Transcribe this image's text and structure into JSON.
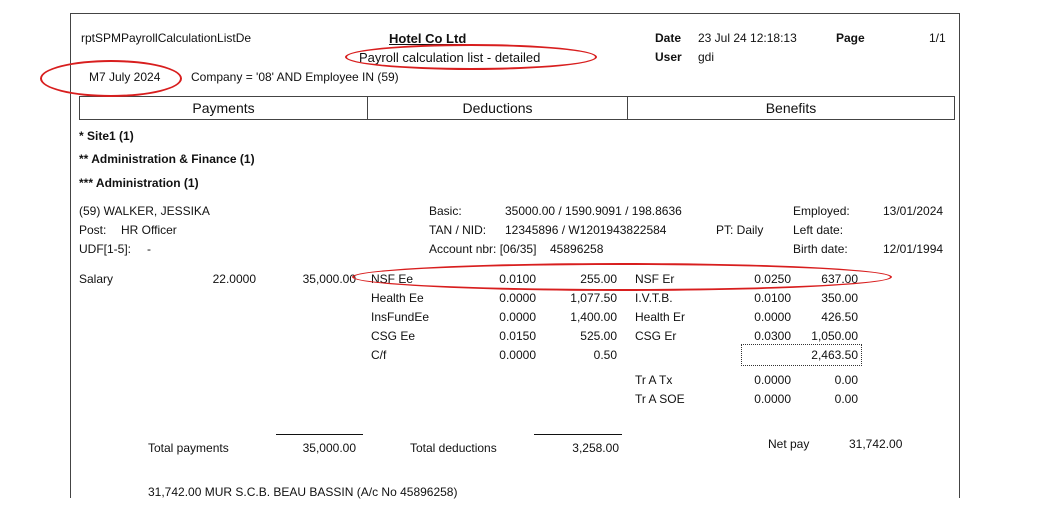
{
  "header": {
    "report_id": "rptSPMPayrollCalculationListDe",
    "company_name": "Hotel Co Ltd",
    "subtitle": "Payroll calculation list - detailed",
    "period": "M7 July 2024",
    "filter": "Company = '08' AND Employee IN (59)",
    "date_label": "Date",
    "date_value": "23 Jul 24 12:18:13",
    "page_label": "Page",
    "page_value": "1/1",
    "user_label": "User",
    "user_value": "gdi"
  },
  "sections": {
    "payments": "Payments",
    "deductions": "Deductions",
    "benefits": "Benefits"
  },
  "groups": {
    "level1": "* Site1 (1)",
    "level2": "** Administration & Finance (1)",
    "level3": "*** Administration (1)"
  },
  "employee": {
    "name": "(59) WALKER, JESSIKA",
    "post_label": "Post:",
    "post_value": "HR Officer",
    "udf_label": "UDF[1-5]:",
    "udf_value": "-",
    "basic_label": "Basic:",
    "basic_value": "35000.00 / 1590.9091 / 198.8636",
    "tan_label": "TAN / NID:",
    "tan_value": "12345896 / W1201943822584",
    "pt": "PT: Daily",
    "account_label": "Account nbr: [06/35]",
    "account_value": "45896258",
    "employed_label": "Employed:",
    "employed_value": "13/01/2024",
    "left_label": "Left date:",
    "birth_label": "Birth date:",
    "birth_value": "12/01/1994"
  },
  "payments": [
    {
      "name": "Salary",
      "rate": "22.0000",
      "amount": "35,000.00"
    }
  ],
  "deductions": [
    {
      "name": "NSF Ee",
      "rate": "0.0100",
      "amount": "255.00"
    },
    {
      "name": "Health Ee",
      "rate": "0.0000",
      "amount": "1,077.50"
    },
    {
      "name": "InsFundEe",
      "rate": "0.0000",
      "amount": "1,400.00"
    },
    {
      "name": "CSG Ee",
      "rate": "0.0150",
      "amount": "525.00"
    },
    {
      "name": "C/f",
      "rate": "0.0000",
      "amount": "0.50"
    }
  ],
  "benefits": [
    {
      "name": "NSF Er",
      "rate": "0.0250",
      "amount": "637.00"
    },
    {
      "name": "I.V.T.B.",
      "rate": "0.0100",
      "amount": "350.00"
    },
    {
      "name": "Health Er",
      "rate": "0.0000",
      "amount": "426.50"
    },
    {
      "name": "CSG Er",
      "rate": "0.0300",
      "amount": "1,050.00"
    }
  ],
  "benefits_subtotal": "2,463.50",
  "benefits_extra": [
    {
      "name": "Tr A Tx",
      "rate": "0.0000",
      "amount": "0.00"
    },
    {
      "name": "Tr A SOE",
      "rate": "0.0000",
      "amount": "0.00"
    }
  ],
  "totals": {
    "payments_label": "Total payments",
    "payments_value": "35,000.00",
    "deductions_label": "Total deductions",
    "deductions_value": "3,258.00",
    "net_label": "Net pay",
    "net_value": "31,742.00"
  },
  "bank_line": "31,742.00  MUR  S.C.B. BEAU BASSIN (A/c No 45896258)",
  "highlight_color": "#d81e1e"
}
